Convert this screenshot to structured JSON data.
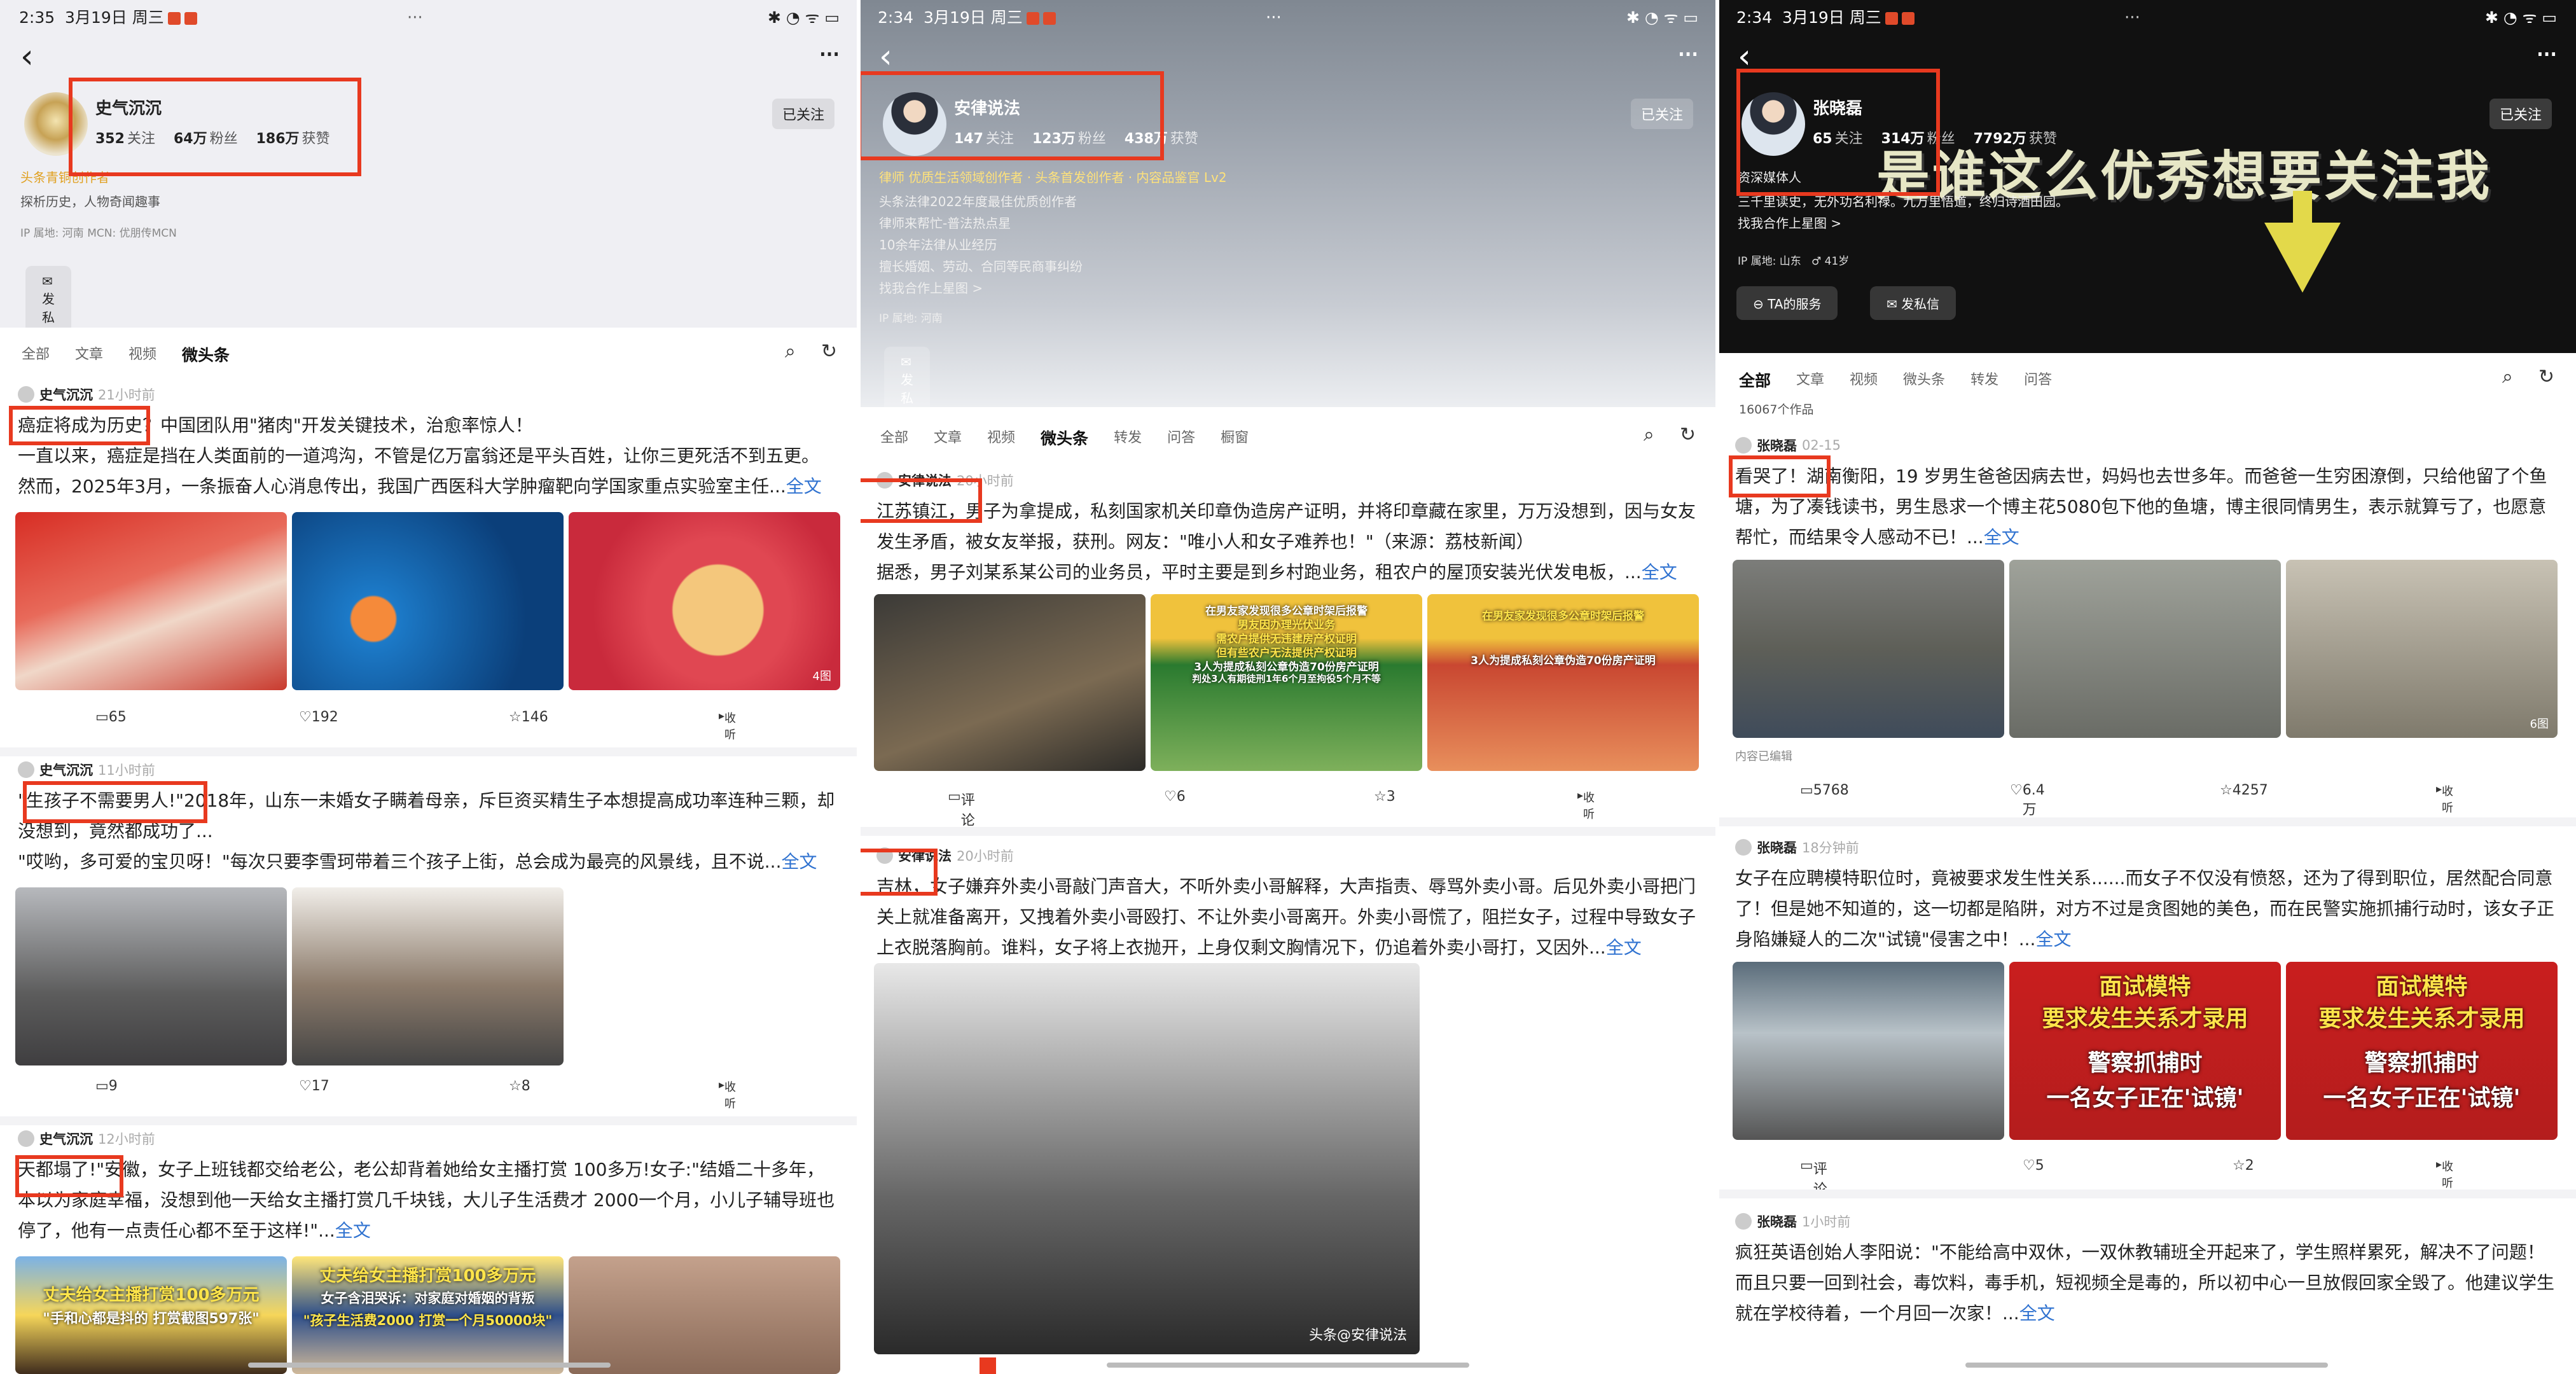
{
  "status": {
    "time": "2:35",
    "time_mid": "2:34",
    "date": "3月19日 周三",
    "dots": "···",
    "icons": "✱ ◔ ᯤ ▭"
  },
  "colors": {
    "accent_red": "#e8391f",
    "link_blue": "#2f72d0"
  },
  "panels": [
    {
      "profile": {
        "name": "史气沉沉",
        "following": "352",
        "following_label": "关注",
        "fans": "64万",
        "fans_label": "粉丝",
        "likes": "186万",
        "likes_label": "获赞",
        "follow_btn": "已关注",
        "badge": "头条青铜创作者",
        "bio": "探析历史，人物奇闻趣事",
        "ip": "IP 属地: 河南   MCN: 优朋传MCN",
        "msg_btn": "发私信"
      },
      "tabs": [
        "全部",
        "文章",
        "视频",
        "微头条"
      ],
      "posts": [
        {
          "user": "史气沉沉",
          "time": "21小时前",
          "text": "癌症将成为历史？中国团队用\"猪肉\"开发关键技术，治愈率惊人！\n一直以来，癌症是挡在人类面前的一道鸿沟，不管是亿万富翁还是平头百姓，让你三更死活不到五更。\n然而，2025年3月，一条振奋人心消息传出，我国广西医科大学肿瘤靶向学国家重点实验室主任...",
          "more": "全文",
          "img_count": "4图",
          "comments": "65",
          "likes": "192",
          "stars": "146",
          "collect": "收听"
        },
        {
          "user": "史气沉沉",
          "time": "11小时前",
          "text": "\"生孩子不需要男人!\"2018年，山东一未婚女子瞒着母亲，斥巨资买精生子本想提高成功率连种三颗，却没想到，竟然都成功了...\n\"哎哟，多可爱的宝贝呀！\"每次只要李雪珂带着三个孩子上街，总会成为最亮的风景线，且不说...",
          "more": "全文",
          "comments": "9",
          "likes": "17",
          "stars": "8",
          "collect": "收听"
        },
        {
          "user": "史气沉沉",
          "time": "12小时前",
          "text": "天都塌了!\"安徽，女子上班钱都交给老公，老公却背着她给女主播打赏 100多万!女子:\"结婚二十多年，本以为家庭幸福，没想到他一天给女主播打赏几千块钱，大儿子生活费才 2000一个月，小儿子辅导班也停了，他有一点责任心都不至于这样!\"...",
          "more": "全文",
          "caps": [
            "丈夫给女主播打赏100多万元",
            "\"手和心都是抖的 打赏截图597张\"",
            "丈夫给女主播打赏100多万元",
            "女子含泪哭诉：对家庭对婚姻的背叛",
            "\"孩子生活费2000 打赏一个月50000块\""
          ]
        }
      ]
    },
    {
      "profile": {
        "name": "安律说法",
        "following": "147",
        "following_label": "关注",
        "fans": "123万",
        "fans_label": "粉丝",
        "likes": "438万",
        "likes_label": "获赞",
        "follow_btn": "已关注",
        "badge": "律师 优质生活领域创作者 · 头条首发创作者 · 内容品鉴官 Lv2",
        "bio": "头条法律2022年度最佳优质创作者\n律师来帮忙-普法热点星\n10余年法律从业经历\n擅长婚姻、劳动、合同等民商事纠纷\n找我合作上星图 >",
        "ip": "IP 属地: 河南",
        "msg_btn": "发私信"
      },
      "tabs": [
        "全部",
        "文章",
        "视频",
        "微头条",
        "转发",
        "问答",
        "橱窗"
      ],
      "posts": [
        {
          "user": "安律说法",
          "time": "20小时前",
          "text": "江苏镇江，男子为拿提成，私刻国家机关印章伪造房产证明，并将印章藏在家里，万万没想到，因与女友发生矛盾，被女友举报，获刑。网友：\"唯小人和女子难养也！\"（来源：荔枝新闻）\n据悉，男子刘某系某公司的业务员，平时主要是到乡村跑业务，租农户的屋顶安装光伏发电板，...",
          "more": "全文",
          "caps": [
            "在男友家发现很多公章时架后报警",
            "男友因办理光伏业务",
            "需农户提供无违建房产权证明",
            "但有些农户无法提供产权证明",
            "3人为提成私刻公章伪造70份房产证明",
            "判处3人有期徒刑1年6个月至拘役5个月不等"
          ],
          "comments": "评论",
          "likes": "6",
          "stars": "3",
          "collect": "收听"
        },
        {
          "user": "安律说法",
          "time": "20小时前",
          "text": "吉林，女子嫌弃外卖小哥敲门声音大，不听外卖小哥解释，大声指责、辱骂外卖小哥。后见外卖小哥把门关上就准备离开，又拽着外卖小哥殴打、不让外卖小哥离开。外卖小哥慌了，阻拦女子，过程中导致女子上衣脱落胸前。谁料，女子将上衣抛开，上身仅剩文胸情况下，仍追着外卖小哥打，又因外...",
          "more": "全文",
          "watermark": "头条@安律说法"
        }
      ]
    },
    {
      "profile": {
        "name": "张晓磊",
        "following": "65",
        "following_label": "关注",
        "fans": "314万",
        "fans_label": "粉丝",
        "likes": "7792万",
        "likes_label": "获赞",
        "follow_btn": "已关注",
        "badge": "资深媒体人",
        "bio": "三千里读史，无外功名利禄。九万里悟道，终归诗酒田园。\n找我合作上星图 >",
        "ip": "IP 属地: 山东",
        "ip2": "41岁",
        "service_btn": "TA的服务",
        "msg_btn": "发私信",
        "caption": "是谁这么优秀想要关注我"
      },
      "tabs": [
        "全部",
        "文章",
        "视频",
        "微头条",
        "转发",
        "问答"
      ],
      "works_count": "16067个作品",
      "posts": [
        {
          "user": "张晓磊",
          "time": "02-15",
          "text": "看哭了！湖南衡阳，19 岁男生爸爸因病去世，妈妈也去世多年。而爸爸一生穷困潦倒，只给他留了个鱼塘，为了凑钱读书，男生恳求一个博主花5080包下他的鱼塘，博主很同情男生，表示就算亏了，也愿意帮忙，而结果令人感动不已！...",
          "more": "全文",
          "img_count": "6图",
          "note": "内容已编辑",
          "comments": "5768",
          "likes": "6.4万",
          "stars": "4257",
          "collect": "收听"
        },
        {
          "user": "张晓磊",
          "time": "18分钟前",
          "text": "女子在应聘模特职位时，竟被要求发生性关系......而女子不仅没有愤怒，还为了得到职位，居然配合同意了！但是她不知道的，这一切都是陷阱，对方不过是贪图她的美色，而在民警实施抓捕行动时，该女子正身陷嫌疑人的二次\"试镜\"侵害之中！...",
          "more": "全文",
          "caps": [
            "面试模特",
            "要求发生关系才录用",
            "警察抓捕时",
            "一名女子正在'试镜'"
          ],
          "comments": "评论",
          "likes": "5",
          "stars": "2",
          "collect": "收听"
        },
        {
          "user": "张晓磊",
          "time": "1小时前",
          "text": "疯狂英语创始人李阳说：\"不能给高中双休，一双休教辅班全开起来了，学生照样累死，解决不了问题！而且只要一回到社会，毒饮料，毒手机，短视频全是毒的，所以初中心一旦放假回家全毁了。他建议学生就在学校待着，一个月回一次家！...",
          "more": "全文"
        }
      ]
    }
  ]
}
